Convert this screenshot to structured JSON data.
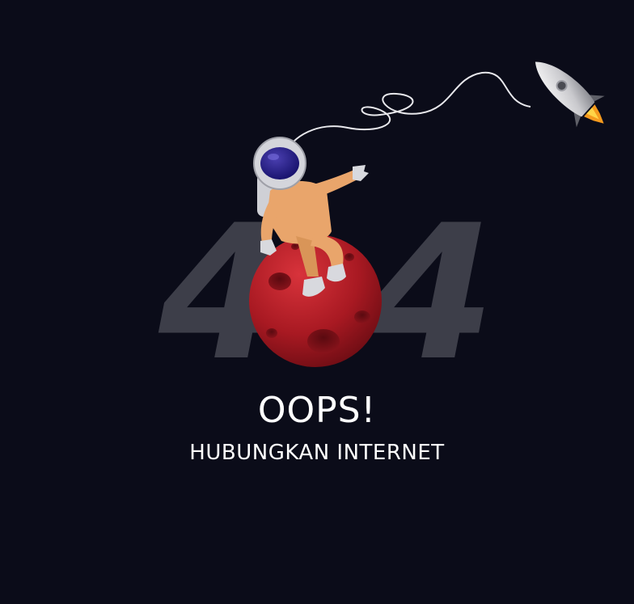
{
  "error_code": {
    "first_digit": "4",
    "last_digit": "4"
  },
  "message": {
    "title": "OOPS!",
    "subtitle": "HUBUNGKAN INTERNET"
  },
  "colors": {
    "background": "#0b0c19",
    "digit": "#3d3e49",
    "planet": "#b01e26",
    "suit": "#e9a56b",
    "text": "#ffffff"
  },
  "icons": {
    "astronaut": "astronaut-illustration",
    "planet": "red-planet-illustration",
    "rocket": "rocket-illustration",
    "tether": "tether-cord"
  }
}
